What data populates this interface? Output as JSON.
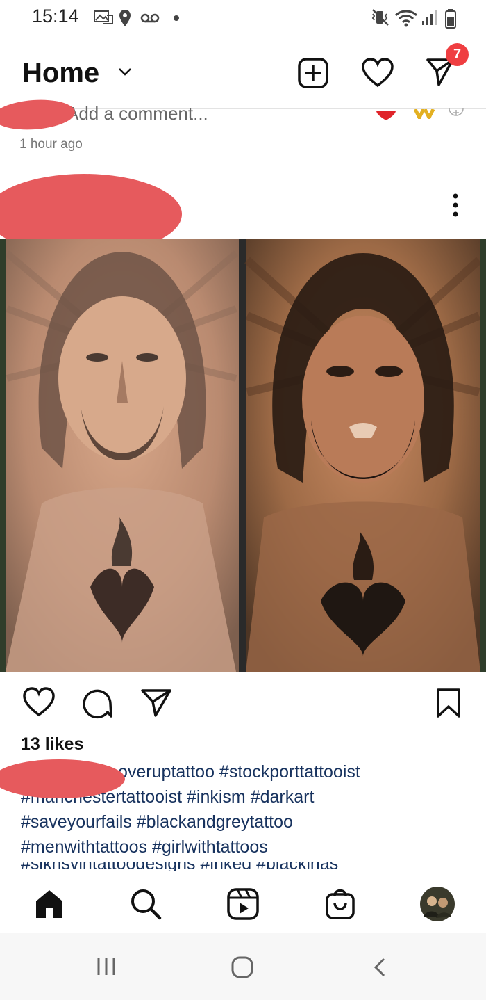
{
  "status_bar": {
    "time": "15:14",
    "left_icons": [
      "image-notification-icon",
      "location-icon",
      "voicemail-icon",
      "dot-icon"
    ],
    "right_icons": [
      "vibrate-icon",
      "wifi-icon",
      "signal-icon",
      "battery-icon"
    ]
  },
  "header": {
    "title": "Home",
    "direct_badge": "7"
  },
  "previous_post": {
    "comment_placeholder": "Add a comment...",
    "time_ago": "1 hour ago"
  },
  "post": {
    "image_description_icon": "tattoo-photo",
    "likes": "13 likes",
    "caption_lines": [
      "overuptattoo #stockporttattooist",
      "#manchestertattooist #inkism #darkart",
      "#saveyourfails #blackandgreytattoo",
      "#menwithtattoos #girlwithtattoos",
      "#sikhsvintattoodesigns #inked #blackinas"
    ]
  },
  "bottom_nav": [
    "home-icon",
    "search-icon",
    "reels-icon",
    "shop-icon",
    "profile-avatar"
  ],
  "system_nav": [
    "recents-icon",
    "home-icon",
    "back-icon"
  ],
  "colors": {
    "accent_badge": "#ef3e41",
    "hashtag": "#17325e",
    "redaction": "#e65a5d"
  }
}
